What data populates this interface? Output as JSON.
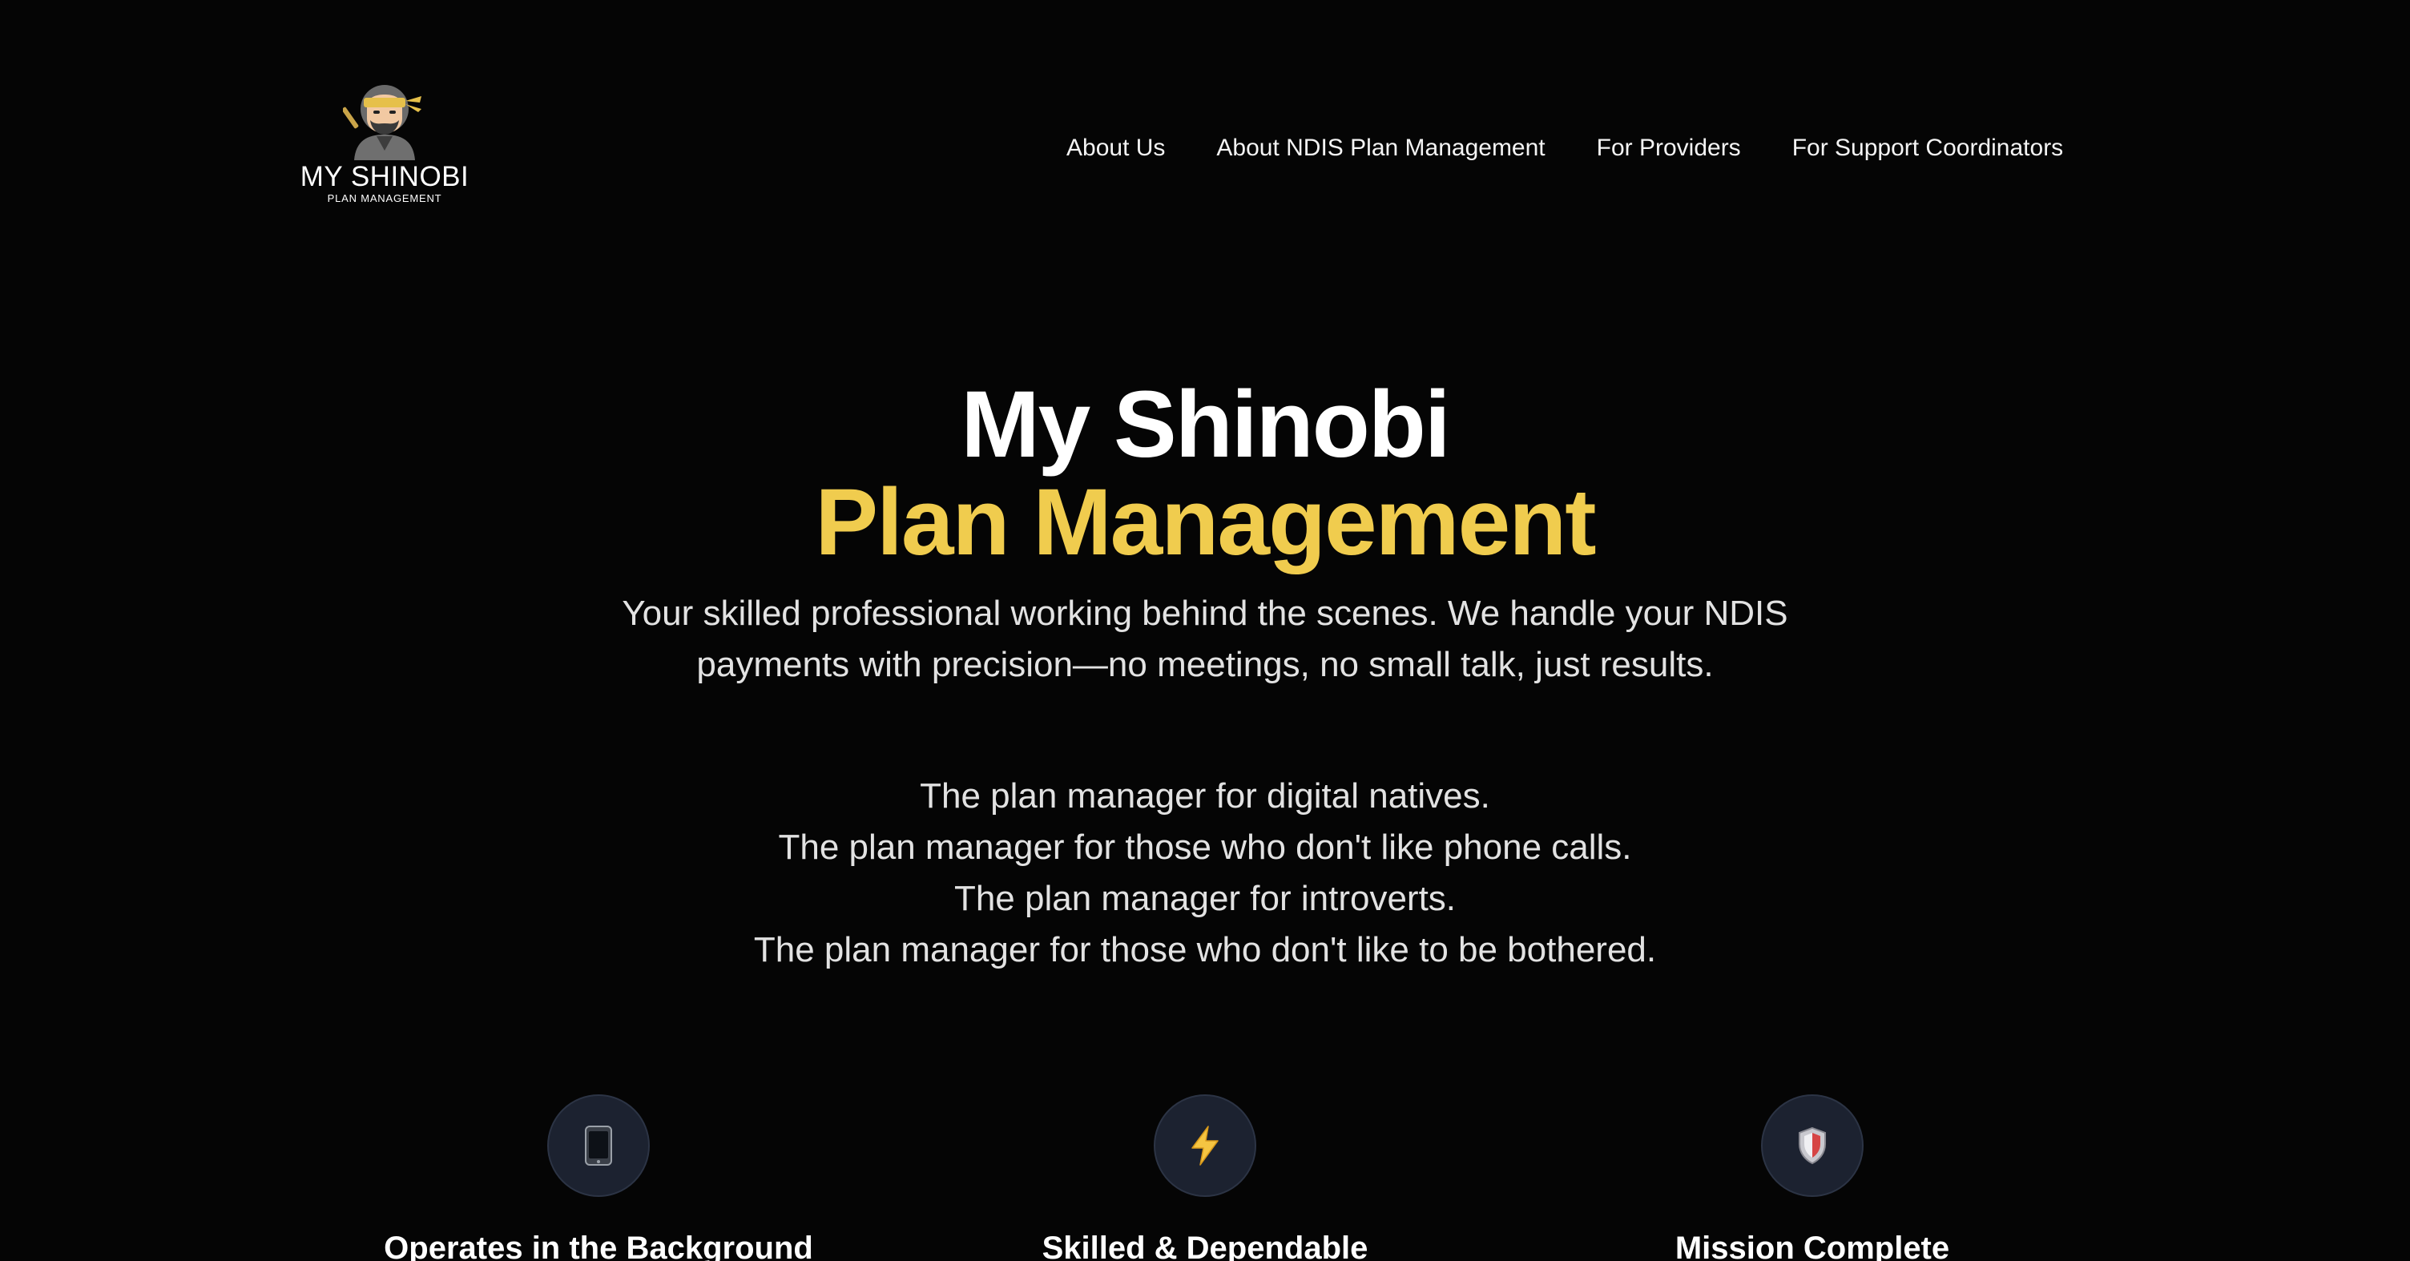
{
  "brand": {
    "name": "MY SHINOBI",
    "subtitle": "PLAN MANAGEMENT",
    "logo_icon": "ninja-mascot-icon"
  },
  "nav": {
    "items": [
      {
        "label": "About Us"
      },
      {
        "label": "About NDIS Plan Management"
      },
      {
        "label": "For Providers"
      },
      {
        "label": "For Support Coordinators"
      }
    ]
  },
  "hero": {
    "title_line1": "My Shinobi",
    "title_line2": "Plan Management",
    "description": "Your skilled professional working behind the scenes. We handle your NDIS payments with precision—no meetings, no small talk, just results.",
    "taglines": [
      "The plan manager for digital natives.",
      "The plan manager for those who don't like phone calls.",
      "The plan manager for introverts.",
      "The plan manager for those who don't like to be bothered."
    ]
  },
  "features": [
    {
      "title": "Operates in the Background",
      "icon": "mobile-phone-icon"
    },
    {
      "title": "Skilled & Dependable",
      "icon": "lightning-bolt-icon"
    },
    {
      "title": "Mission Complete",
      "icon": "shield-icon"
    }
  ],
  "colors": {
    "background": "#050505",
    "accent": "#f0cc4e",
    "text": "#ffffff",
    "muted_text": "#e2e2e2",
    "icon_circle": "#1c2230"
  }
}
